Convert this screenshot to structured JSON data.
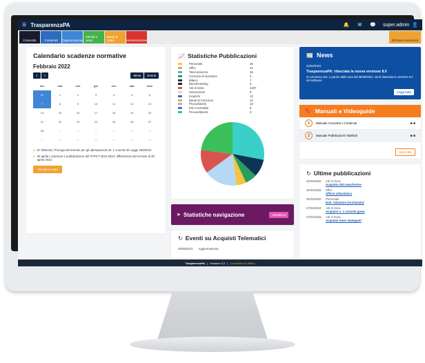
{
  "header": {
    "app": "TrasparenzaPA",
    "user": "super.admin"
  },
  "toolbar": [
    {
      "label": "Cruscotto",
      "color": "#1a1a2e"
    },
    {
      "label": "Contenuti",
      "color": "#2d6cc0"
    },
    {
      "label": "Organizzazione",
      "color": "#3f86d6"
    },
    {
      "label": "Attività e news",
      "color": "#45b24c"
    },
    {
      "label": "Bandi di Gara",
      "color": "#f0a231"
    },
    {
      "label": "Amministrazione",
      "color": "#d8332c"
    }
  ],
  "toolbar_right": "Richiedi Assistenza",
  "calendar": {
    "title": "Calendario scadenze normative",
    "month": "Febbraio 2022",
    "prev": "<",
    "next": ">",
    "btn_mese": "Mese",
    "btn_eventi": "Eventi",
    "days": [
      "lun",
      "mar",
      "mer",
      "gio",
      "ven",
      "sab",
      "dom"
    ],
    "weeks": [
      [
        "31",
        "1",
        "2",
        "3",
        "4",
        "5",
        "6"
      ],
      [
        "7",
        "8",
        "9",
        "10",
        "11",
        "12",
        "13"
      ],
      [
        "14",
        "15",
        "16",
        "17",
        "18",
        "19",
        "20"
      ],
      [
        "21",
        "22",
        "23",
        "24",
        "25",
        "26",
        "27"
      ],
      [
        "28",
        "1",
        "2",
        "3",
        "4",
        "5",
        "6"
      ],
      [
        "7",
        "8",
        "9",
        "10",
        "11",
        "12",
        "13"
      ]
    ],
    "note1": "07 febbraio | Proroga del termine per gli adempimenti art. 1 comma 32 Legge 190/2012",
    "note2": "30 aprile | Adozione e pubblicazione del PTPCT 2022-2024: differimento del termine al 30 aprile 2022",
    "btn_all": "Visualizza tutto"
  },
  "stats": {
    "title": "Statistiche Pubblicazioni",
    "items": [
      {
        "name": "Personale",
        "value": "26",
        "color": "#f4c542"
      },
      {
        "name": "Uffici",
        "value": "21",
        "color": "#e9a440"
      },
      {
        "name": "Tassi assenza",
        "value": "15",
        "color": "#39b5c8"
      },
      {
        "name": "Concorsi di locazione",
        "value": "4",
        "color": "#2a9d5c"
      },
      {
        "name": "Bilanci",
        "value": "7",
        "color": "#0e3557"
      },
      {
        "name": "Benchmarking",
        "value": "6",
        "color": "#222"
      },
      {
        "name": "Atti di Gara",
        "value": "2407",
        "color": "#d9534f"
      },
      {
        "name": "Sovvenzioni",
        "value": "5",
        "color": "#b5d9f4"
      },
      {
        "name": "Incarichi",
        "value": "12",
        "color": "#7a4fb5"
      },
      {
        "name": "Bandi di Concorso",
        "value": "14",
        "color": "#9bcf6e"
      },
      {
        "name": "Procedimenti",
        "value": "10",
        "color": "#f48fb1"
      },
      {
        "name": "Enti Controllati",
        "value": "5",
        "color": "#3a7bd5"
      },
      {
        "name": "Provvedimenti",
        "value": "3",
        "color": "#2ecc71"
      }
    ],
    "pie": [
      {
        "value": 28,
        "color": "#39d0c8"
      },
      {
        "value": 9,
        "color": "#0e3557"
      },
      {
        "value": 6,
        "color": "#2a9d5c"
      },
      {
        "value": 5,
        "color": "#f4c542"
      },
      {
        "value": 17,
        "color": "#b5d9f4"
      },
      {
        "value": 12,
        "color": "#d9534f"
      },
      {
        "value": 23,
        "color": "#3bbf5a"
      }
    ]
  },
  "nav_stats": {
    "label": "Statistiche navigazione",
    "btn": "Visualizza"
  },
  "events": {
    "title": "Eventi su Acquisti Telematici",
    "date": "28/08/2021",
    "text": "Aggiornamento"
  },
  "news": {
    "title": "News",
    "date": "22/04/2021",
    "headline": "TrasparenzaPA: rilasciata la nuova versione 8.0",
    "body": "Si comunica che, a partire dalla sera del 06/05/2021, verrà rilasciata la versione 8.0 del software.",
    "btn": "Leggi tutte"
  },
  "manuals": {
    "title": "Manuali e Videoguide",
    "items": [
      {
        "n": "1",
        "label": "Manuale Cruscotto e Contenuti"
      },
      {
        "n": "2",
        "label": "Manuale Pubblicazioni Tabellari"
      }
    ],
    "btn": "Vedi tutto"
  },
  "last": {
    "title": "Ultime pubblicazioni",
    "items": [
      {
        "date": "31/01/2022",
        "cat": "Atti di Gara",
        "title": "Acquisto 200 mascherine"
      },
      {
        "date": "31/01/2022",
        "cat": "Uffici",
        "title": "Ufficio Urbanistica"
      },
      {
        "date": "31/01/2022",
        "cat": "Personale",
        "title": "Dott. Salvatore [Archiviato]"
      },
      {
        "date": "27/01/2022",
        "cat": "Atti di Gara",
        "title": "Acquisto n. 1 console game"
      },
      {
        "date": "27/01/2022",
        "cat": "Atti di Gara",
        "title": "Acquisto toner stampanti"
      }
    ]
  },
  "footer": {
    "brand": "TrasparenzaPA",
    "version": "Versione 3.2",
    "link": "Condizioni di utilizzo"
  }
}
